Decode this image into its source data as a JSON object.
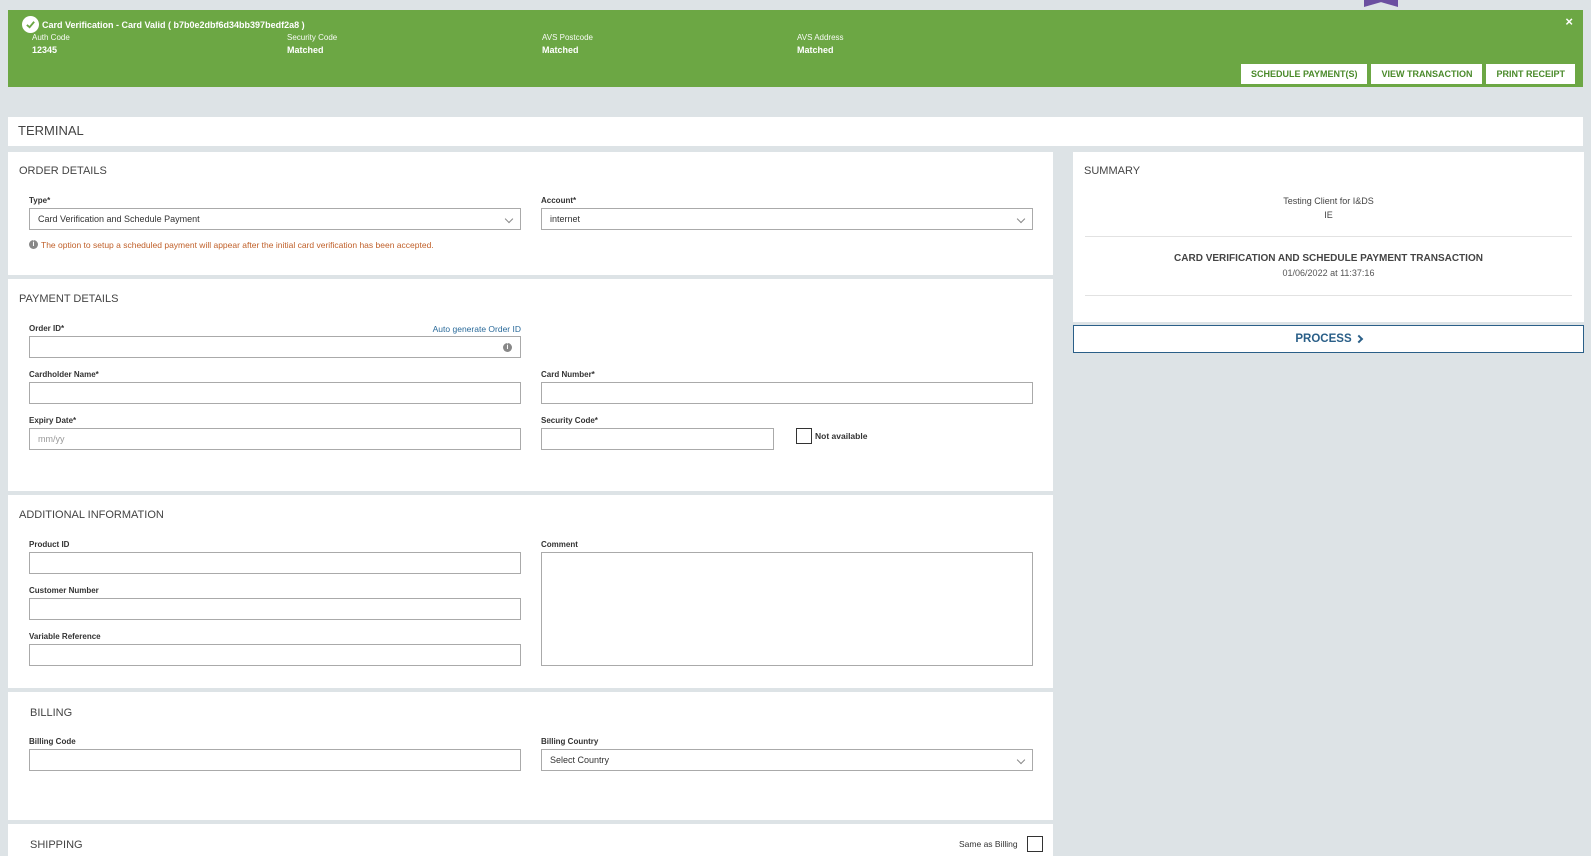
{
  "banner": {
    "title": "Card Verification - Card Valid ( b7b0e2dbf6d34bb397bedf2a8 )",
    "fields": [
      {
        "label": "Auth Code",
        "value": "12345"
      },
      {
        "label": "Security Code",
        "value": "Matched"
      },
      {
        "label": "AVS Postcode",
        "value": "Matched"
      },
      {
        "label": "AVS Address",
        "value": "Matched"
      }
    ],
    "close_label": "×",
    "buttons": {
      "schedule": "SCHEDULE PAYMENT(S)",
      "view": "VIEW TRANSACTION",
      "print": "PRINT RECEIPT"
    },
    "color": "#6ca744"
  },
  "terminal": {
    "title": "TERMINAL"
  },
  "order": {
    "title": "ORDER DETAILS",
    "type_label": "Type*",
    "type_value": "Card Verification and Schedule Payment",
    "account_label": "Account*",
    "account_value": "internet",
    "note": "The option to setup a scheduled payment will appear after the initial card verification has been accepted."
  },
  "payment": {
    "title": "PAYMENT DETAILS",
    "order_id_label": "Order ID*",
    "auto_generate": "Auto generate Order ID",
    "cardholder_label": "Cardholder Name*",
    "card_number_label": "Card Number*",
    "expiry_label": "Expiry Date*",
    "expiry_placeholder": "mm/yy",
    "security_label": "Security Code*",
    "not_available": "Not available"
  },
  "additional": {
    "title": "ADDITIONAL INFORMATION",
    "product_label": "Product ID",
    "customer_label": "Customer Number",
    "variable_label": "Variable Reference",
    "comment_label": "Comment"
  },
  "billing": {
    "title": "BILLING",
    "code_label": "Billing Code",
    "country_label": "Billing Country",
    "country_value": "Select Country"
  },
  "shipping": {
    "title": "SHIPPING",
    "same_as_billing": "Same as Billing"
  },
  "summary": {
    "title": "SUMMARY",
    "client": "Testing Client for I&DS",
    "country": "IE",
    "transaction_type": "CARD VERIFICATION AND SCHEDULE PAYMENT TRANSACTION",
    "datetime": "01/06/2022 at 11:37:16",
    "process_label": "PROCESS"
  }
}
